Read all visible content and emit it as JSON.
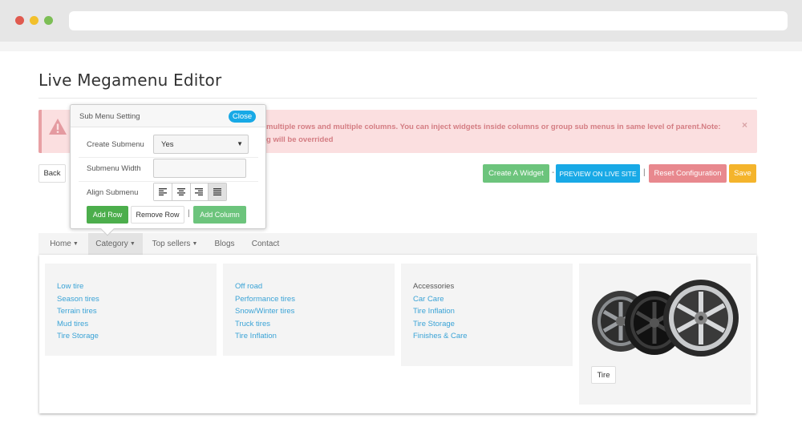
{
  "page": {
    "title": "Live Megamenu Editor"
  },
  "alert": {
    "text_line1": "multiple rows and multiple columns. You can inject widgets inside columns or group sub menus in same level of parent.Note:",
    "text_line2": "g will be overrided",
    "close_label": "×",
    "icon": "warning-icon"
  },
  "toolbar": {
    "back_label": "Back",
    "create_widget_label": "Create A Widget",
    "sep1": "-",
    "preview_label": "PREVIEW ON LIVE SITE",
    "sep2": "|",
    "reset_label": "Reset Configuration",
    "save_label": "Save"
  },
  "popup": {
    "title": "Sub Menu Setting",
    "close_label": "Close",
    "create_submenu_label": "Create Submenu",
    "create_submenu_value": "Yes",
    "submenu_width_label": "Submenu Width",
    "submenu_width_value": "",
    "align_submenu_label": "Align Submenu",
    "align_icons": [
      "align-left-icon",
      "align-center-icon",
      "align-right-icon",
      "align-justify-icon"
    ],
    "add_row_label": "Add Row",
    "remove_row_label": "Remove Row",
    "sep": "|",
    "add_column_label": "Add Column"
  },
  "nav": {
    "items": [
      {
        "label": "Home",
        "caret": true
      },
      {
        "label": "Category",
        "caret": true,
        "active": true
      },
      {
        "label": "Top sellers",
        "caret": true
      },
      {
        "label": "Blogs",
        "caret": false
      },
      {
        "label": "Contact",
        "caret": false
      }
    ]
  },
  "mega": {
    "columns": [
      {
        "items": [
          "Low tire",
          "Season tires",
          "Terrain tires",
          "Mud tires",
          "Tire Storage"
        ]
      },
      {
        "items": [
          "Off road",
          "Performance tires",
          "Snow/Winter tires",
          "Truck tires",
          "Tire Inflation"
        ]
      },
      {
        "heading": "Accessories",
        "items": [
          "Car Care",
          "Tire Inflation",
          "Tire Storage",
          "Finishes & Care"
        ]
      }
    ],
    "widget": {
      "button_label": "Tire"
    }
  },
  "colors": {
    "link": "#3aa3d6",
    "alert_bg": "#fbdfe0",
    "alert_text": "#d47d83",
    "green": "#6cc47c",
    "blue": "#18a9e6",
    "red": "#e8888e",
    "orange": "#f4b42c"
  }
}
